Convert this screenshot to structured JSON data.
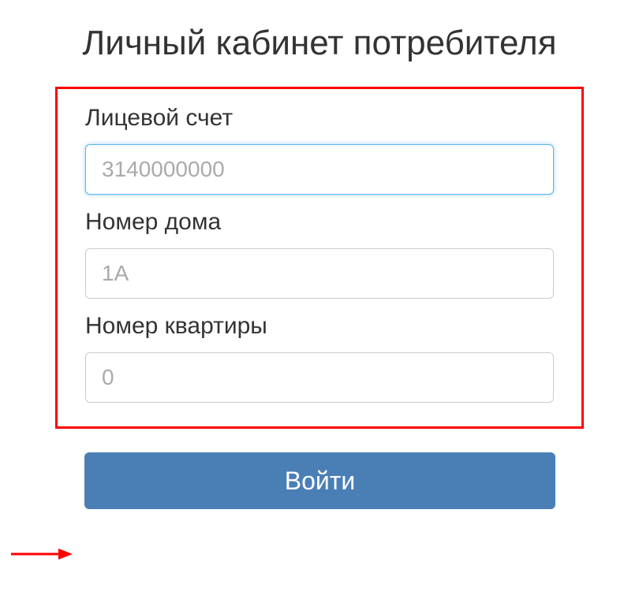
{
  "page": {
    "title": "Личный кабинет потребителя"
  },
  "form": {
    "account": {
      "label": "Лицевой счет",
      "placeholder": "3140000000",
      "value": ""
    },
    "house": {
      "label": "Номер дома",
      "placeholder": "1А",
      "value": ""
    },
    "apartment": {
      "label": "Номер квартиры",
      "placeholder": "0",
      "value": ""
    }
  },
  "actions": {
    "login_label": "Войти"
  },
  "annotation": {
    "arrow_color": "#ff0000",
    "box_color": "#ff0000"
  }
}
